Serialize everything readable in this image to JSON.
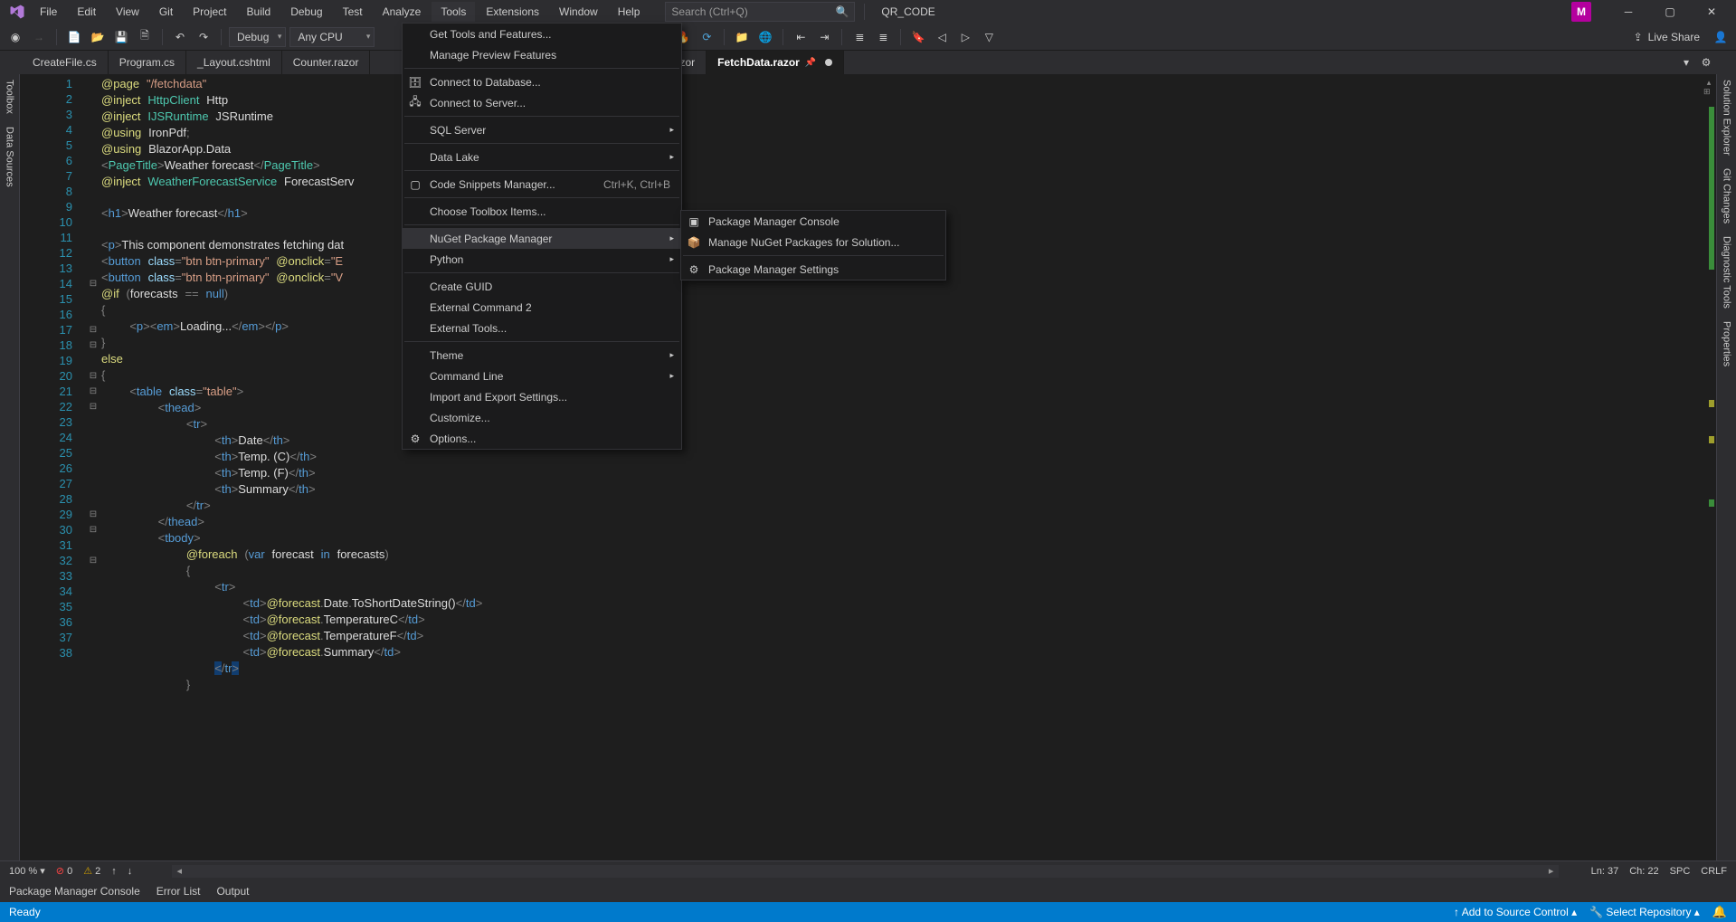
{
  "titlebar": {
    "menus": [
      "File",
      "Edit",
      "View",
      "Git",
      "Project",
      "Build",
      "Debug",
      "Test",
      "Analyze",
      "Tools",
      "Extensions",
      "Window",
      "Help"
    ],
    "active_menu": "Tools",
    "search_placeholder": "Search (Ctrl+Q)",
    "project_name": "QR_CODE",
    "user_initial": "M"
  },
  "toolbar": {
    "config": "Debug",
    "platform": "Any CPU",
    "live_share": "Live Share"
  },
  "tabs": [
    {
      "label": "CreateFile.cs",
      "active": false
    },
    {
      "label": "Program.cs",
      "active": false
    },
    {
      "label": "_Layout.cshtml",
      "active": false
    },
    {
      "label": "Counter.razor",
      "active": false
    },
    {
      "label": "x.razor",
      "active": false
    },
    {
      "label": "FetchData.razor",
      "active": true,
      "pinned": true,
      "unsaved": true
    }
  ],
  "sidebars": {
    "left": [
      "Toolbox",
      "Data Sources"
    ],
    "right": [
      "Solution Explorer",
      "Git Changes",
      "Diagnostic Tools",
      "Properties"
    ]
  },
  "editor": {
    "lines": 38
  },
  "editor_status": {
    "zoom": "100 %",
    "errors": "0",
    "warnings": "2",
    "ln": "Ln: 37",
    "ch": "Ch: 22",
    "spc": "SPC",
    "crlf": "CRLF"
  },
  "bottom_tabs": [
    "Package Manager Console",
    "Error List",
    "Output"
  ],
  "statusbar": {
    "ready": "Ready",
    "add_source": "Add to Source Control",
    "select_repo": "Select Repository"
  },
  "menu_tools": [
    {
      "label": "Get Tools and Features..."
    },
    {
      "label": "Manage Preview Features"
    },
    {
      "sep": true
    },
    {
      "label": "Connect to Database...",
      "icon": "🗄"
    },
    {
      "label": "Connect to Server...",
      "icon": "🖧"
    },
    {
      "sep": true
    },
    {
      "label": "SQL Server",
      "arrow": true
    },
    {
      "sep": true
    },
    {
      "label": "Data Lake",
      "arrow": true
    },
    {
      "sep": true
    },
    {
      "label": "Code Snippets Manager...",
      "shortcut": "Ctrl+K, Ctrl+B",
      "icon": "▢"
    },
    {
      "sep": true
    },
    {
      "label": "Choose Toolbox Items..."
    },
    {
      "sep": true
    },
    {
      "label": "NuGet Package Manager",
      "arrow": true,
      "highlighted": true
    },
    {
      "label": "Python",
      "arrow": true
    },
    {
      "sep": true
    },
    {
      "label": "Create GUID"
    },
    {
      "label": "External Command 2"
    },
    {
      "label": "External Tools..."
    },
    {
      "sep": true
    },
    {
      "label": "Theme",
      "arrow": true
    },
    {
      "label": "Command Line",
      "arrow": true
    },
    {
      "label": "Import and Export Settings..."
    },
    {
      "label": "Customize..."
    },
    {
      "label": "Options...",
      "icon": "⚙"
    }
  ],
  "menu_nuget": [
    {
      "label": "Package Manager Console",
      "icon": "▣"
    },
    {
      "label": "Manage NuGet Packages for Solution...",
      "icon": "📦"
    },
    {
      "sep": true
    },
    {
      "label": "Package Manager Settings",
      "icon": "⚙"
    }
  ]
}
